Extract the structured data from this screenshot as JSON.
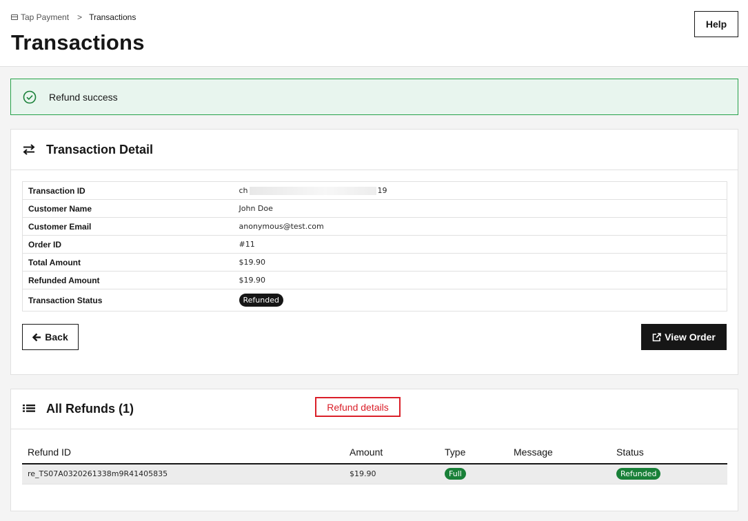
{
  "breadcrumb": {
    "root": "Tap Payment",
    "separator": ">",
    "current": "Transactions"
  },
  "page": {
    "title": "Transactions",
    "help_label": "Help"
  },
  "alert": {
    "message": "Refund success",
    "color": "#24a148"
  },
  "detail": {
    "title": "Transaction Detail",
    "rows": [
      {
        "label": "Transaction ID",
        "value_prefix": "ch",
        "value_suffix": "19"
      },
      {
        "label": "Customer Name",
        "value": "John Doe"
      },
      {
        "label": "Customer Email",
        "value": "anonymous@test.com"
      },
      {
        "label": "Order ID",
        "value": "#11"
      },
      {
        "label": "Total Amount",
        "value": "$19.90"
      },
      {
        "label": "Refunded Amount",
        "value": "$19.90"
      },
      {
        "label": "Transaction Status",
        "value": "Refunded"
      }
    ],
    "back_label": "Back",
    "view_order_label": "View Order"
  },
  "refunds": {
    "title": "All Refunds (1)",
    "annotation": "Refund details",
    "columns": [
      "Refund ID",
      "Amount",
      "Type",
      "Message",
      "Status"
    ],
    "rows": [
      {
        "id": "re_TS07A0320261338m9R41405835",
        "amount": "$19.90",
        "type": "Full",
        "message": "",
        "status": "Refunded"
      }
    ]
  },
  "icons": {
    "alert": "checkmark-circle-icon",
    "detail": "arrows-exchange-icon",
    "refunds": "list-icon",
    "back": "arrow-left-icon",
    "view": "external-link-icon"
  }
}
